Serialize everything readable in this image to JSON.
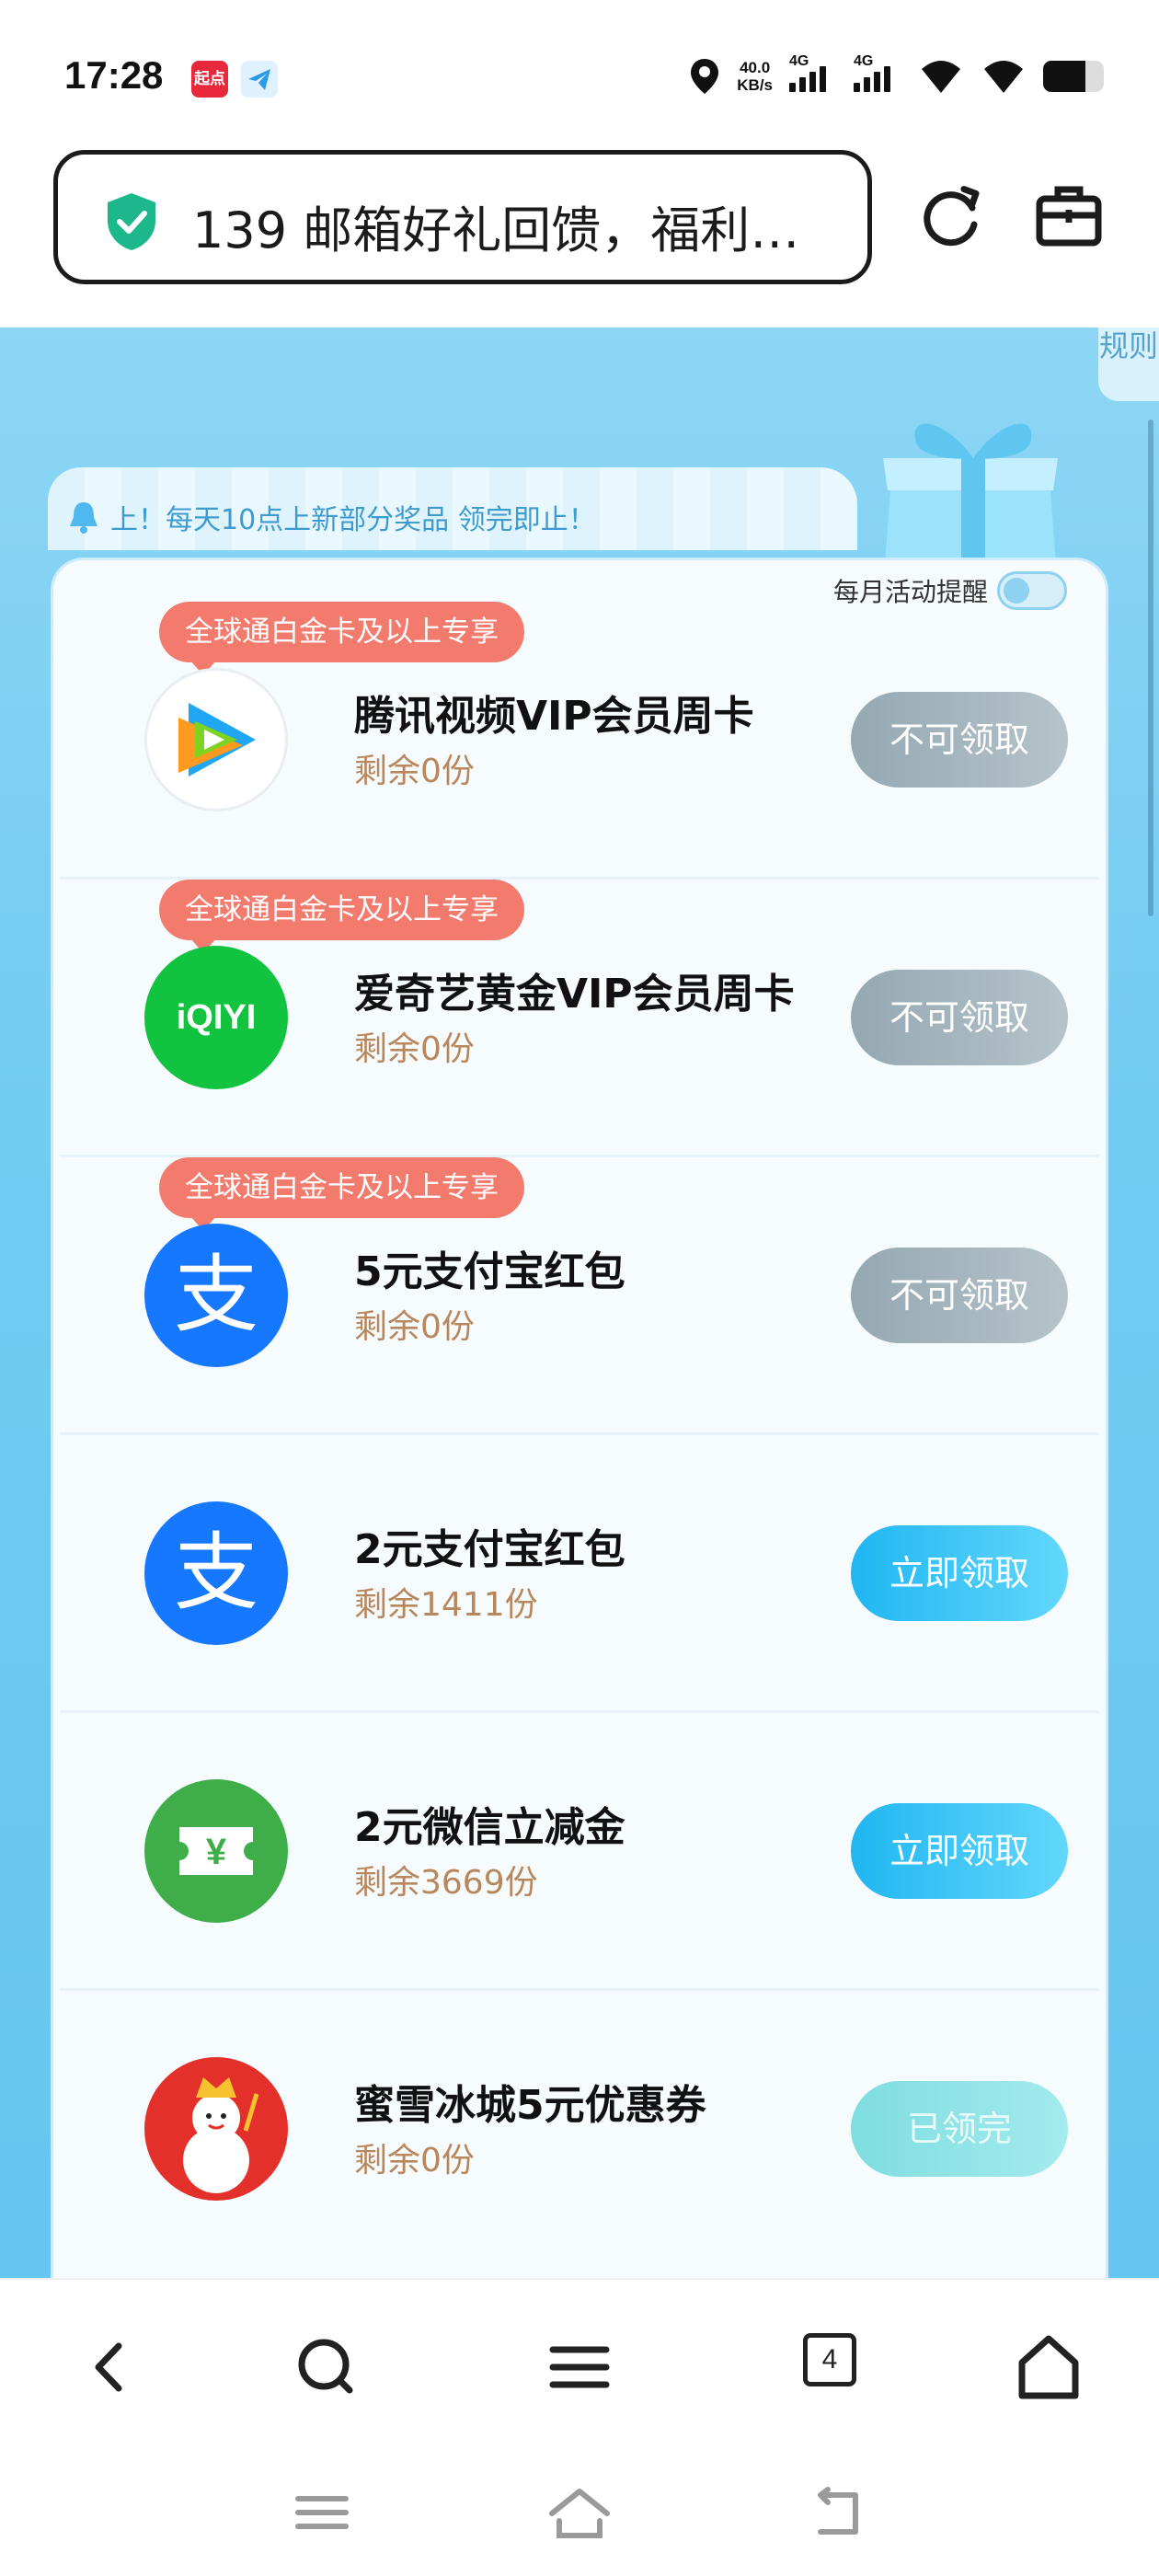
{
  "status_bar": {
    "time": "17:28",
    "app_badge": "起点",
    "net_speed": "40.0",
    "net_unit": "KB/s",
    "signal1": "4G",
    "signal2": "4G",
    "battery_level": 0.7
  },
  "address_bar": {
    "url_text": "139 邮箱好礼回馈，福利…",
    "icons": [
      "shield-check-icon",
      "refresh-icon",
      "briefcase-icon"
    ]
  },
  "page": {
    "rules_label": "规则",
    "notice": "上！每天10点上新部分奖品 领完即止！",
    "remind_label": "每月活动提醒",
    "remind_on": false
  },
  "prizes": [
    {
      "tag": "全球通白金卡及以上专享",
      "title": "腾讯视频VIP会员周卡",
      "remaining": "剩余0份",
      "button": "不可领取",
      "state": "disabled",
      "icon": "tencent-video-icon"
    },
    {
      "tag": "全球通白金卡及以上专享",
      "title": "爱奇艺黄金VIP会员周卡",
      "remaining": "剩余0份",
      "button": "不可领取",
      "state": "disabled",
      "icon": "iqiyi-icon",
      "icon_text": "iQIYI"
    },
    {
      "tag": "全球通白金卡及以上专享",
      "title": "5元支付宝红包",
      "remaining": "剩余0份",
      "button": "不可领取",
      "state": "disabled",
      "icon": "alipay-icon",
      "icon_text": "支"
    },
    {
      "title": "2元支付宝红包",
      "remaining": "剩余1411份",
      "button": "立即领取",
      "state": "active",
      "icon": "alipay-icon",
      "icon_text": "支"
    },
    {
      "title": "2元微信立减金",
      "remaining": "剩余3669份",
      "button": "立即领取",
      "state": "active",
      "icon": "wechat-coupon-icon",
      "icon_text": "¥"
    },
    {
      "title": "蜜雪冰城5元优惠券",
      "remaining": "剩余0份",
      "button": "已领完",
      "state": "done",
      "icon": "mixue-snowman-icon"
    }
  ],
  "browser_bar": {
    "items": [
      "back-icon",
      "search-icon",
      "menu-icon",
      "tabs-icon",
      "home-icon"
    ],
    "tab_count": "4"
  },
  "system_nav": {
    "items": [
      "recents-icon",
      "home-icon",
      "back-icon"
    ]
  }
}
